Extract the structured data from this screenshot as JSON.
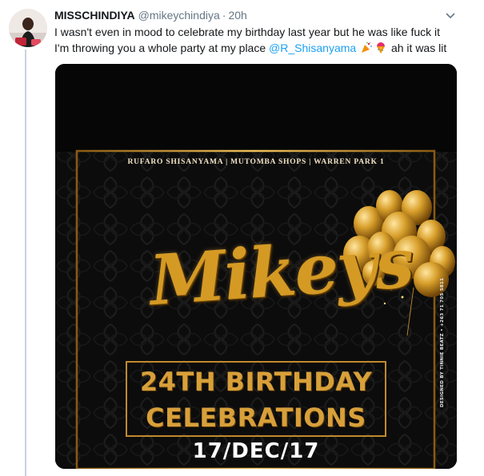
{
  "tweet": {
    "display_name": "MISSCHINDIYA",
    "handle": "@mikeychindiya",
    "separator": "·",
    "time": "20h",
    "text_line1": "I wasn't even in mood to celebrate my birthday last year but he was like fuck it",
    "text_line2_prefix": "I'm throwing you a whole party at my place ",
    "mention": "@R_Shisanyama",
    "text_line2_suffix": "ah it was lit",
    "emoji_1": "party-popper-icon",
    "emoji_2": "confetti-ball-icon"
  },
  "flyer": {
    "subtitle": "RUFARO SHISANYAMA | MUTOMBA SHOPS | WARREN PARK 1",
    "title": "Mikeys",
    "line1": "24TH BIRTHDAY",
    "line2": "CELEBRATIONS",
    "date": "17/DEC/17",
    "credit": "DESIGNED BY TINNIE BEATZ • +263 71 705 5811"
  },
  "colors": {
    "thread_line": "#c4d4e3",
    "mention": "#1da1f2",
    "gold": "#d49a24",
    "flyer_bg": "#0b0b0b"
  }
}
